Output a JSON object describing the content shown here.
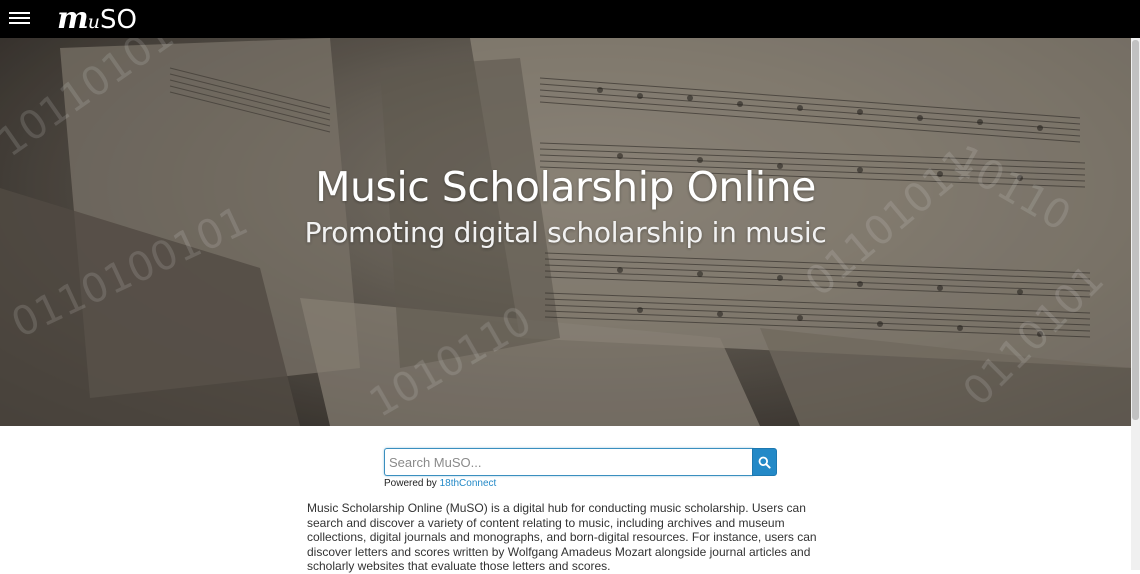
{
  "header": {
    "menu_icon": "hamburger-icon",
    "logo": {
      "m": "m",
      "u": "u",
      "so": "SO"
    }
  },
  "hero": {
    "title": "Music Scholarship Online",
    "subtitle": "Promoting digital scholarship in music"
  },
  "search": {
    "placeholder": "Search MuSO...",
    "button_icon": "search-icon",
    "powered_by_label": "Powered by",
    "powered_by_link": "18thConnect"
  },
  "intro": {
    "text": "Music Scholarship Online (MuSO) is a digital hub for conducting music scholarship. Users can search and discover a variety of content relating to music, including archives and museum collections, digital journals and monographs, and born-digital resources. For instance, users can discover letters and scores written by Wolfgang Amadeus Mozart alongside journal articles and scholarly websites that evaluate those letters and scores."
  },
  "colors": {
    "topbar": "#000000",
    "accent": "#2389c7",
    "body_text": "#333333"
  }
}
